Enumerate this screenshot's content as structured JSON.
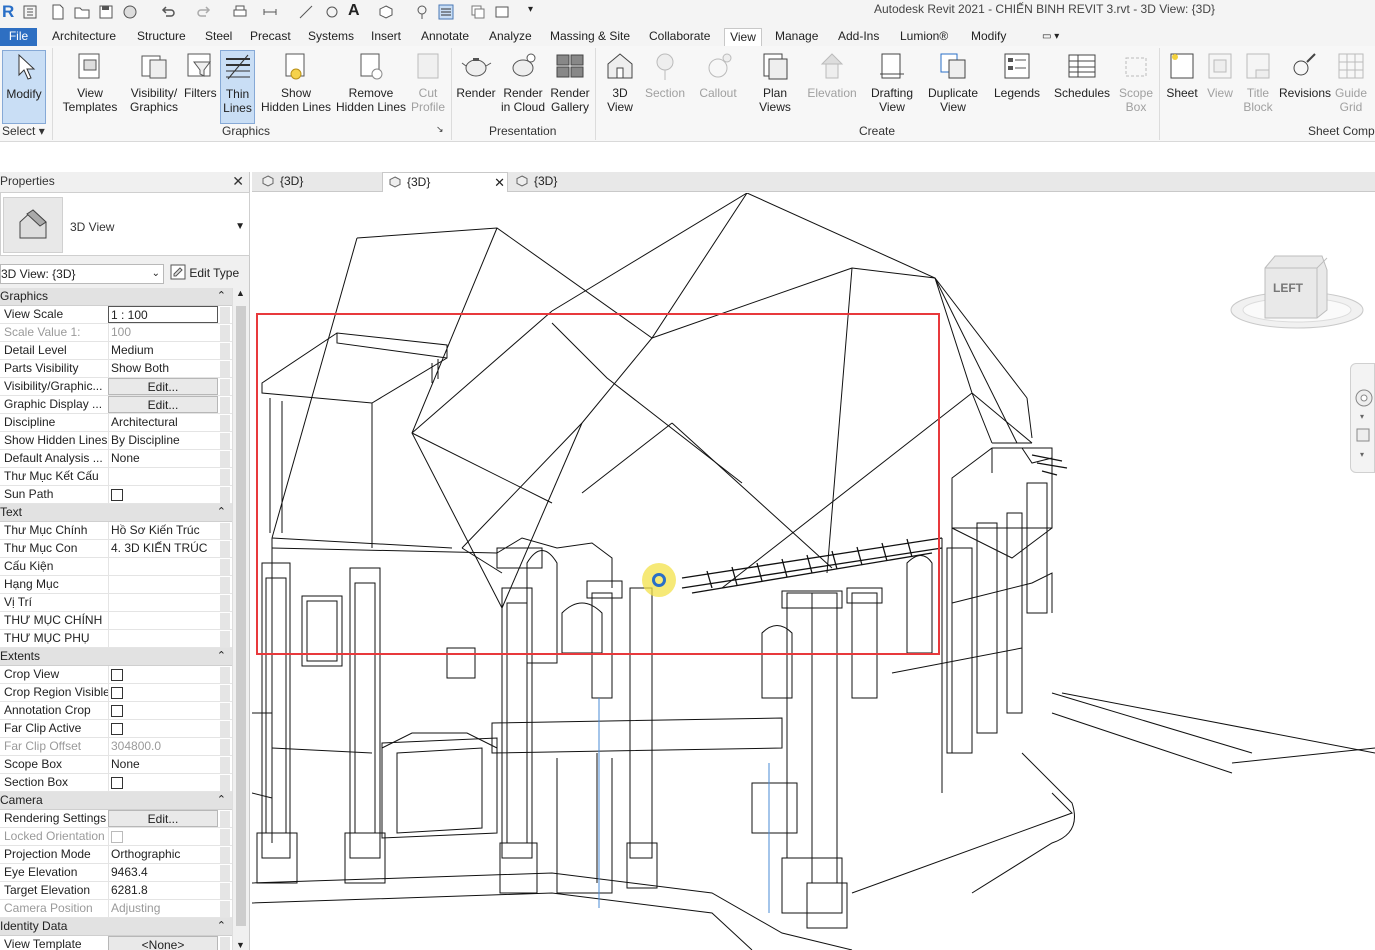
{
  "title_bar": {
    "app_title": "Autodesk Revit 2021 - CHIẾN BINH REVIT 3.rvt - 3D View: {3D}",
    "logo": "R"
  },
  "ribbon_tabs": [
    {
      "label": "File"
    },
    {
      "label": "Architecture"
    },
    {
      "label": "Structure"
    },
    {
      "label": "Steel"
    },
    {
      "label": "Precast"
    },
    {
      "label": "Systems"
    },
    {
      "label": "Insert"
    },
    {
      "label": "Annotate"
    },
    {
      "label": "Analyze"
    },
    {
      "label": "Massing & Site"
    },
    {
      "label": "Collaborate"
    },
    {
      "label": "View"
    },
    {
      "label": "Manage"
    },
    {
      "label": "Add-Ins"
    },
    {
      "label": "Lumion®"
    },
    {
      "label": "Modify"
    }
  ],
  "active_tab": "View",
  "ribbon": {
    "modify": {
      "label": "Modify"
    },
    "select": {
      "label": "Select"
    },
    "graphics": {
      "panel_label": "Graphics",
      "view_templates": "View\nTemplates",
      "visibility_graphics": "Visibility/\nGraphics",
      "filters": "Filters",
      "thin_lines": "Thin\nLines",
      "show_hidden_lines": "Show\nHidden Lines",
      "remove_hidden_lines": "Remove\nHidden Lines",
      "cut_profile": "Cut\nProfile"
    },
    "presentation": {
      "panel_label": "Presentation",
      "render": "Render",
      "render_in_cloud": "Render\nin Cloud",
      "render_gallery": "Render\nGallery"
    },
    "create": {
      "panel_label": "Create",
      "view_3d": "3D\nView",
      "section": "Section",
      "callout": "Callout",
      "plan_views": "Plan\nViews",
      "elevation": "Elevation",
      "drafting_view": "Drafting\nView",
      "duplicate_view": "Duplicate\nView",
      "legends": "Legends",
      "schedules": "Schedules",
      "scope_box": "Scope\nBox"
    },
    "sheet": {
      "panel_label": "Sheet Comp",
      "sheet": "Sheet",
      "view": "View",
      "title_block": "Title\nBlock",
      "revisions": "Revisions",
      "guide_grid": "Guide\nGrid"
    }
  },
  "properties": {
    "title": "Properties",
    "type_name": "3D View",
    "view_selector": "3D View: {3D}",
    "edit_type": "Edit Type",
    "sections": [
      {
        "name": "Graphics",
        "rows": [
          {
            "key": "View Scale",
            "value": "1 : 100",
            "kind": "input"
          },
          {
            "key": "Scale Value    1:",
            "value": "100",
            "kind": "grey"
          },
          {
            "key": "Detail Level",
            "value": "Medium"
          },
          {
            "key": "Parts Visibility",
            "value": "Show Both"
          },
          {
            "key": "Visibility/Graphic...",
            "value": "Edit...",
            "kind": "button"
          },
          {
            "key": "Graphic Display ...",
            "value": "Edit...",
            "kind": "button"
          },
          {
            "key": "Discipline",
            "value": "Architectural"
          },
          {
            "key": "Show Hidden Lines",
            "value": "By Discipline"
          },
          {
            "key": "Default Analysis ...",
            "value": "None"
          },
          {
            "key": "Thư Mục Kết Cấu",
            "value": ""
          },
          {
            "key": "Sun Path",
            "value": "",
            "kind": "check"
          }
        ]
      },
      {
        "name": "Text",
        "rows": [
          {
            "key": "Thư Mục Chính",
            "value": "Hồ Sơ Kiến Trúc"
          },
          {
            "key": "Thư Mục Con",
            "value": "4. 3D KIẾN TRÚC"
          },
          {
            "key": "Cấu Kiện",
            "value": ""
          },
          {
            "key": "Hạng Mục",
            "value": ""
          },
          {
            "key": "Vị Trí",
            "value": ""
          },
          {
            "key": "THƯ MỤC CHÍNH",
            "value": ""
          },
          {
            "key": "THƯ MỤC PHỤ",
            "value": ""
          }
        ]
      },
      {
        "name": "Extents",
        "rows": [
          {
            "key": "Crop View",
            "value": "",
            "kind": "check"
          },
          {
            "key": "Crop Region Visible",
            "value": "",
            "kind": "check"
          },
          {
            "key": "Annotation Crop",
            "value": "",
            "kind": "check"
          },
          {
            "key": "Far Clip Active",
            "value": "",
            "kind": "check"
          },
          {
            "key": "Far Clip Offset",
            "value": "304800.0",
            "kind": "grey"
          },
          {
            "key": "Scope Box",
            "value": "None"
          },
          {
            "key": "Section Box",
            "value": "",
            "kind": "check"
          }
        ]
      },
      {
        "name": "Camera",
        "rows": [
          {
            "key": "Rendering Settings",
            "value": "Edit...",
            "kind": "button"
          },
          {
            "key": "Locked Orientation",
            "value": "",
            "kind": "greycheck"
          },
          {
            "key": "Projection Mode",
            "value": "Orthographic"
          },
          {
            "key": "Eye Elevation",
            "value": "9463.4"
          },
          {
            "key": "Target Elevation",
            "value": "6281.8"
          },
          {
            "key": "Camera Position",
            "value": "Adjusting",
            "kind": "grey"
          }
        ]
      },
      {
        "name": "Identity Data",
        "rows": [
          {
            "key": "View Template",
            "value": "<None>",
            "kind": "button"
          }
        ]
      }
    ]
  },
  "view_tabs": [
    {
      "label": "{3D}"
    },
    {
      "label": "{3D}",
      "active": true
    },
    {
      "label": "{3D}"
    }
  ],
  "viewcube": {
    "face": "LEFT"
  },
  "colors": {
    "file_tab": "#2e6fc2",
    "selection_box": "#e8393c",
    "cursor_highlight": "#f3e24a",
    "thin_lines_active": "#c9def5"
  }
}
